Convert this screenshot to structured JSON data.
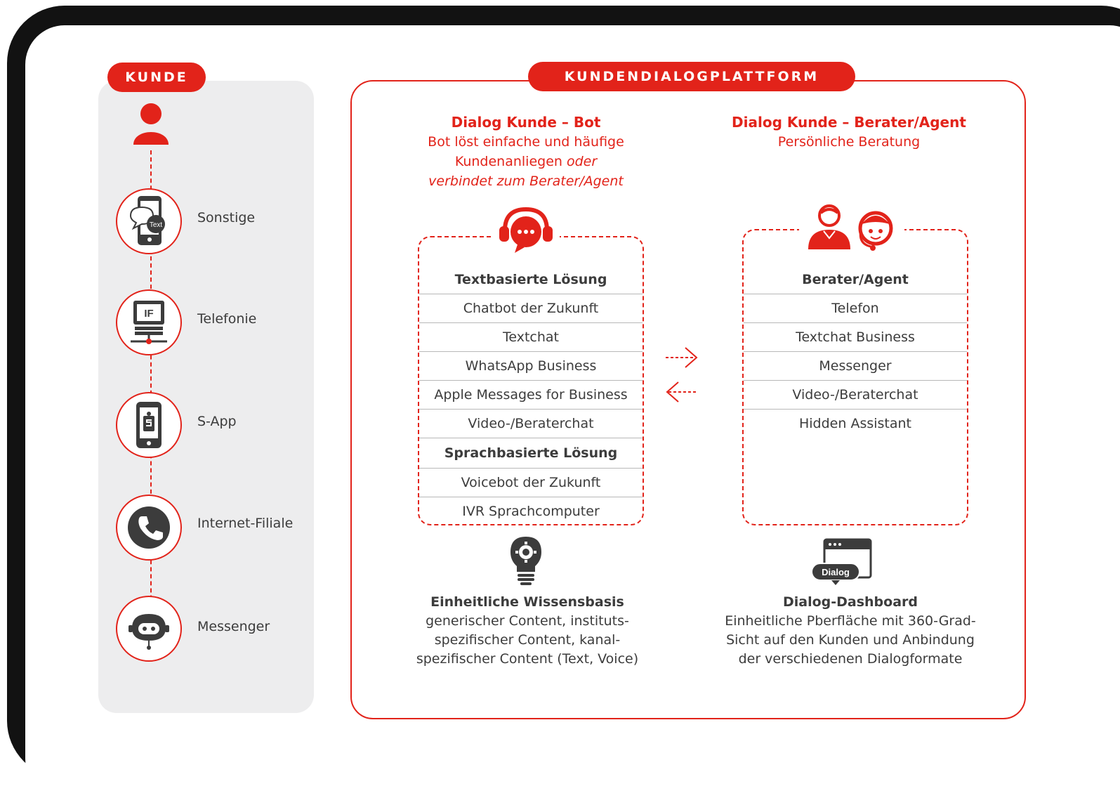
{
  "colors": {
    "accent": "#e2231a",
    "panel": "#ededee",
    "text": "#3c3c3c"
  },
  "kunde": {
    "title": "KUNDE",
    "channels": [
      {
        "label": "Sonstige",
        "icon": "phone-chat-icon"
      },
      {
        "label": "Telefonie",
        "icon": "computer-network-icon"
      },
      {
        "label": "S-App",
        "icon": "sparkasse-app-icon"
      },
      {
        "label": "Internet-Filiale",
        "icon": "telephone-icon"
      },
      {
        "label": "Messenger",
        "icon": "robot-icon"
      }
    ],
    "icon_texts": {
      "sonstige_bubble": "Text",
      "telefonie_screen": "IF"
    }
  },
  "platform": {
    "title": "KUNDENDIALOGPLATTFORM",
    "bot": {
      "title": "Dialog Kunde – Bot",
      "subtitle_1": "Bot löst einfache und häufige",
      "subtitle_2": "Kundenanliegen",
      "subtitle_2_italic": "oder",
      "subtitle_3": "verbindet zum Berater/Agent",
      "rows": [
        {
          "text": "Textbasierte Lösung",
          "header": true
        },
        {
          "text": "Chatbot der Zukunft"
        },
        {
          "text": "Textchat"
        },
        {
          "text": "WhatsApp Business"
        },
        {
          "text": "Apple Messages for Business"
        },
        {
          "text": "Video-/Beraterchat"
        },
        {
          "text": "Sprachbasierte Lösung",
          "header": true
        },
        {
          "text": "Voicebot der Zukunft"
        },
        {
          "text": "IVR Sprachcomputer"
        }
      ]
    },
    "agent": {
      "title": "Dialog Kunde – Berater/Agent",
      "subtitle": "Persönliche Beratung",
      "rows": [
        {
          "text": "Berater/Agent",
          "header": true
        },
        {
          "text": "Telefon"
        },
        {
          "text": "Textchat Business"
        },
        {
          "text": "Messenger"
        },
        {
          "text": "Video-/Beraterchat"
        },
        {
          "text": "Hidden Assistant"
        }
      ]
    },
    "knowledge": {
      "title": "Einheitliche Wissensbasis",
      "lines": [
        "generischer Content, instituts-",
        "spezifischer Content, kanal-",
        "spezifischer Content (Text, Voice)"
      ]
    },
    "dashboard": {
      "badge": "Dialog",
      "title": "Dialog-Dashboard",
      "lines": [
        "Einheitliche Pberfläche mit 360-Grad-",
        "Sicht auf den Kunden und Anbindung",
        "der verschiedenen Dialogformate"
      ]
    }
  }
}
